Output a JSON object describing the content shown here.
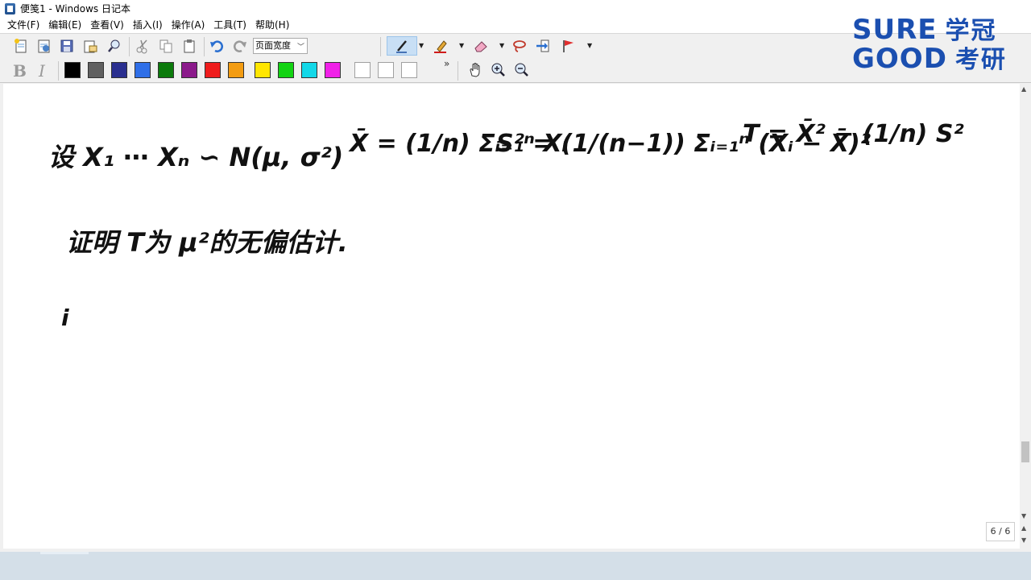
{
  "window": {
    "title": "便笺1 - Windows 日记本"
  },
  "menu": [
    "文件(F)",
    "编辑(E)",
    "查看(V)",
    "插入(I)",
    "操作(A)",
    "工具(T)",
    "帮助(H)"
  ],
  "toolbar": {
    "page_width_select": "页面宽度",
    "more_label": "»"
  },
  "format": {
    "bold": "B",
    "italic": "I"
  },
  "colors": [
    "#000000",
    "#606060",
    "#2a2f8f",
    "#2f6fe8",
    "#0b7a0b",
    "#8b1a8b",
    "#ef1c1c",
    "#f39c12",
    "#ffe600",
    "#13d313",
    "#13d8e8",
    "#f020e8"
  ],
  "logo": {
    "line1": "SURE",
    "line1_cn": "学冠",
    "line2": "GOOD",
    "line2_cn": "考研"
  },
  "note": {
    "line1": "设 X₁ ⋯ Xₙ ∽ N(μ, σ²)",
    "xbar_formula": "X̄ = (1/n) Σᵢ₌₁ⁿ Xᵢ",
    "s2_formula": "S² = (1/(n−1)) Σᵢ₌₁ⁿ (Xᵢ − X̄)²",
    "t_formula": "T = X̄² − (1/n) S²",
    "line2": "证明 T为 μ²的无偏估计.",
    "line3": "i"
  },
  "page_indicator": "6 / 6"
}
